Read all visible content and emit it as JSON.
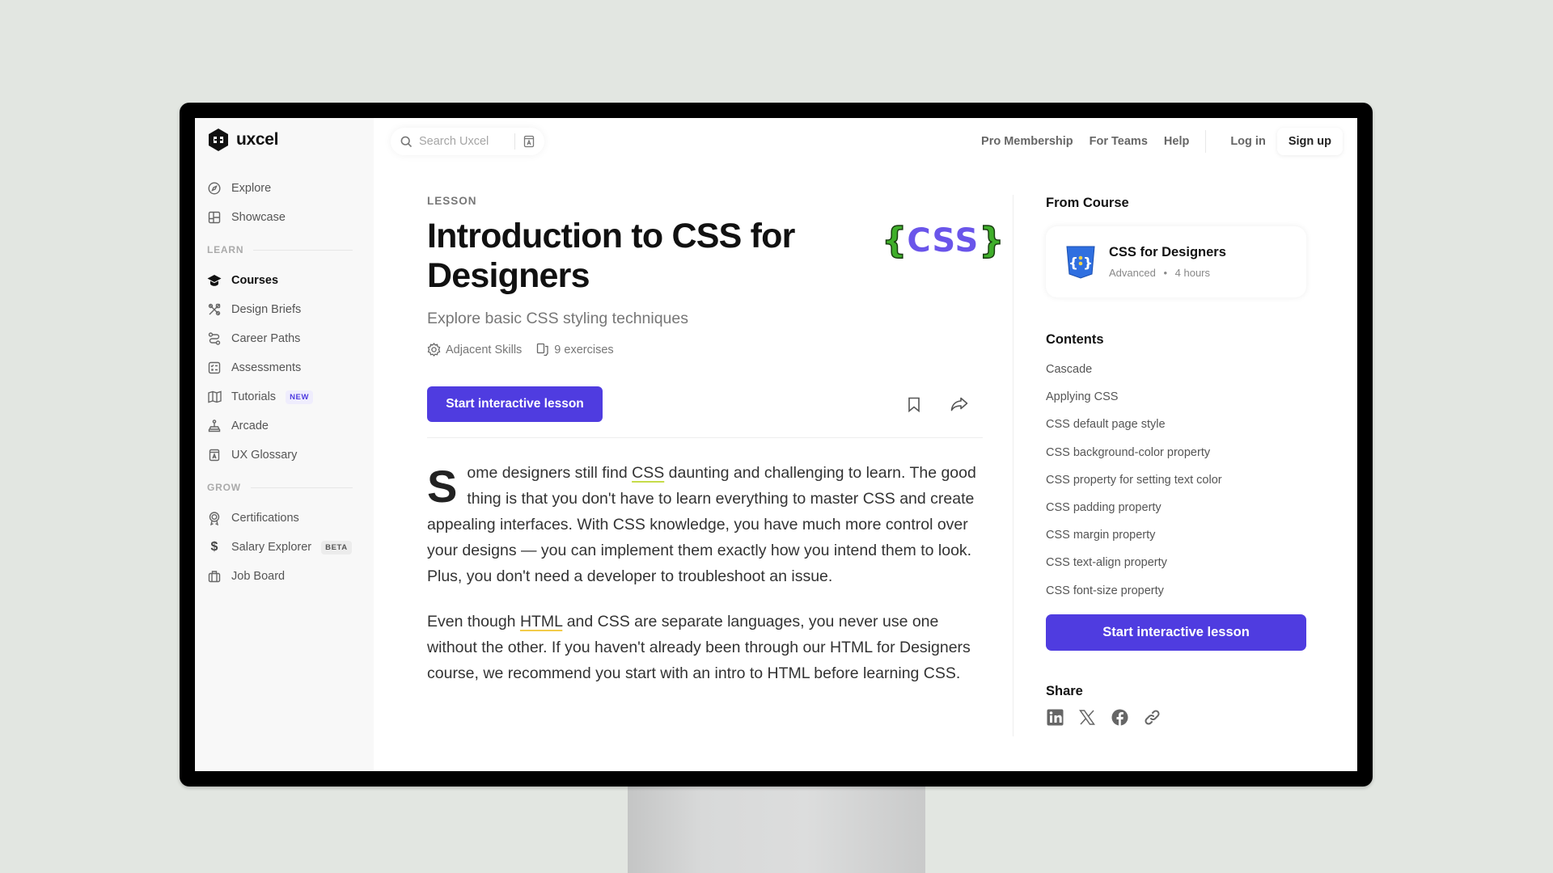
{
  "app": {
    "brand": "uxcel"
  },
  "search": {
    "placeholder": "Search Uxcel"
  },
  "topnav": {
    "pro": "Pro Membership",
    "teams": "For Teams",
    "help": "Help",
    "login": "Log in",
    "signup": "Sign up"
  },
  "sidebar": {
    "top_items": [
      {
        "label": "Explore",
        "icon": "compass-icon"
      },
      {
        "label": "Showcase",
        "icon": "layout-icon"
      }
    ],
    "learn_label": "LEARN",
    "learn_items": [
      {
        "label": "Courses",
        "icon": "graduation-cap-icon",
        "active": true
      },
      {
        "label": "Design Briefs",
        "icon": "tools-icon"
      },
      {
        "label": "Career Paths",
        "icon": "route-icon"
      },
      {
        "label": "Assessments",
        "icon": "checklist-icon"
      },
      {
        "label": "Tutorials",
        "icon": "book-open-icon",
        "badge": "NEW"
      },
      {
        "label": "Arcade",
        "icon": "joystick-icon"
      },
      {
        "label": "UX Glossary",
        "icon": "glossary-icon"
      }
    ],
    "grow_label": "GROW",
    "grow_items": [
      {
        "label": "Certifications",
        "icon": "award-icon"
      },
      {
        "label": "Salary Explorer",
        "icon": "dollar-icon",
        "badge": "BETA"
      },
      {
        "label": "Job Board",
        "icon": "briefcase-icon"
      }
    ]
  },
  "lesson": {
    "eyebrow": "LESSON",
    "title": "Introduction to CSS for Designers",
    "logo_text": "CSS",
    "logo_open": "{",
    "logo_close": "}",
    "subtitle": "Explore basic CSS styling techniques",
    "meta_skill": "Adjacent Skills",
    "meta_exercises": "9 exercises",
    "start_label": "Start interactive lesson",
    "dropcap": "S",
    "p1_a": "ome designers still find ",
    "p1_link": "CSS",
    "p1_b": " daunting and challenging to learn. The good thing is that you don't have to learn everything to master CSS and create appealing interfaces. With CSS knowledge, you have much more control over your designs — you can implement them exactly how you intend them to look. Plus, you don't need a developer to troubleshoot an issue.",
    "p2_a": "Even though ",
    "p2_link": "HTML",
    "p2_b": " and CSS are separate languages, you never use one without the other. If you haven't already been through our HTML for Designers course, we recommend you start with an intro to HTML before learning CSS."
  },
  "right": {
    "from_course_label": "From Course",
    "course": {
      "name": "CSS for Designers",
      "level": "Advanced",
      "duration": "4 hours",
      "sep": "•"
    },
    "contents_label": "Contents",
    "contents": [
      "Cascade",
      "Applying CSS",
      "CSS default page style",
      "CSS background-color property",
      "CSS property for setting text color",
      "CSS padding property",
      "CSS margin property",
      "CSS text-align property",
      "CSS font-size property"
    ],
    "start_label": "Start interactive lesson",
    "share_label": "Share",
    "share_icons": [
      "linkedin-icon",
      "x-icon",
      "facebook-icon",
      "link-icon"
    ]
  },
  "colors": {
    "accent": "#4f3ce0",
    "css_green": "#3fae2a",
    "css_purple": "#6a55ea",
    "css_badge_blue": "#2f6fe0"
  }
}
